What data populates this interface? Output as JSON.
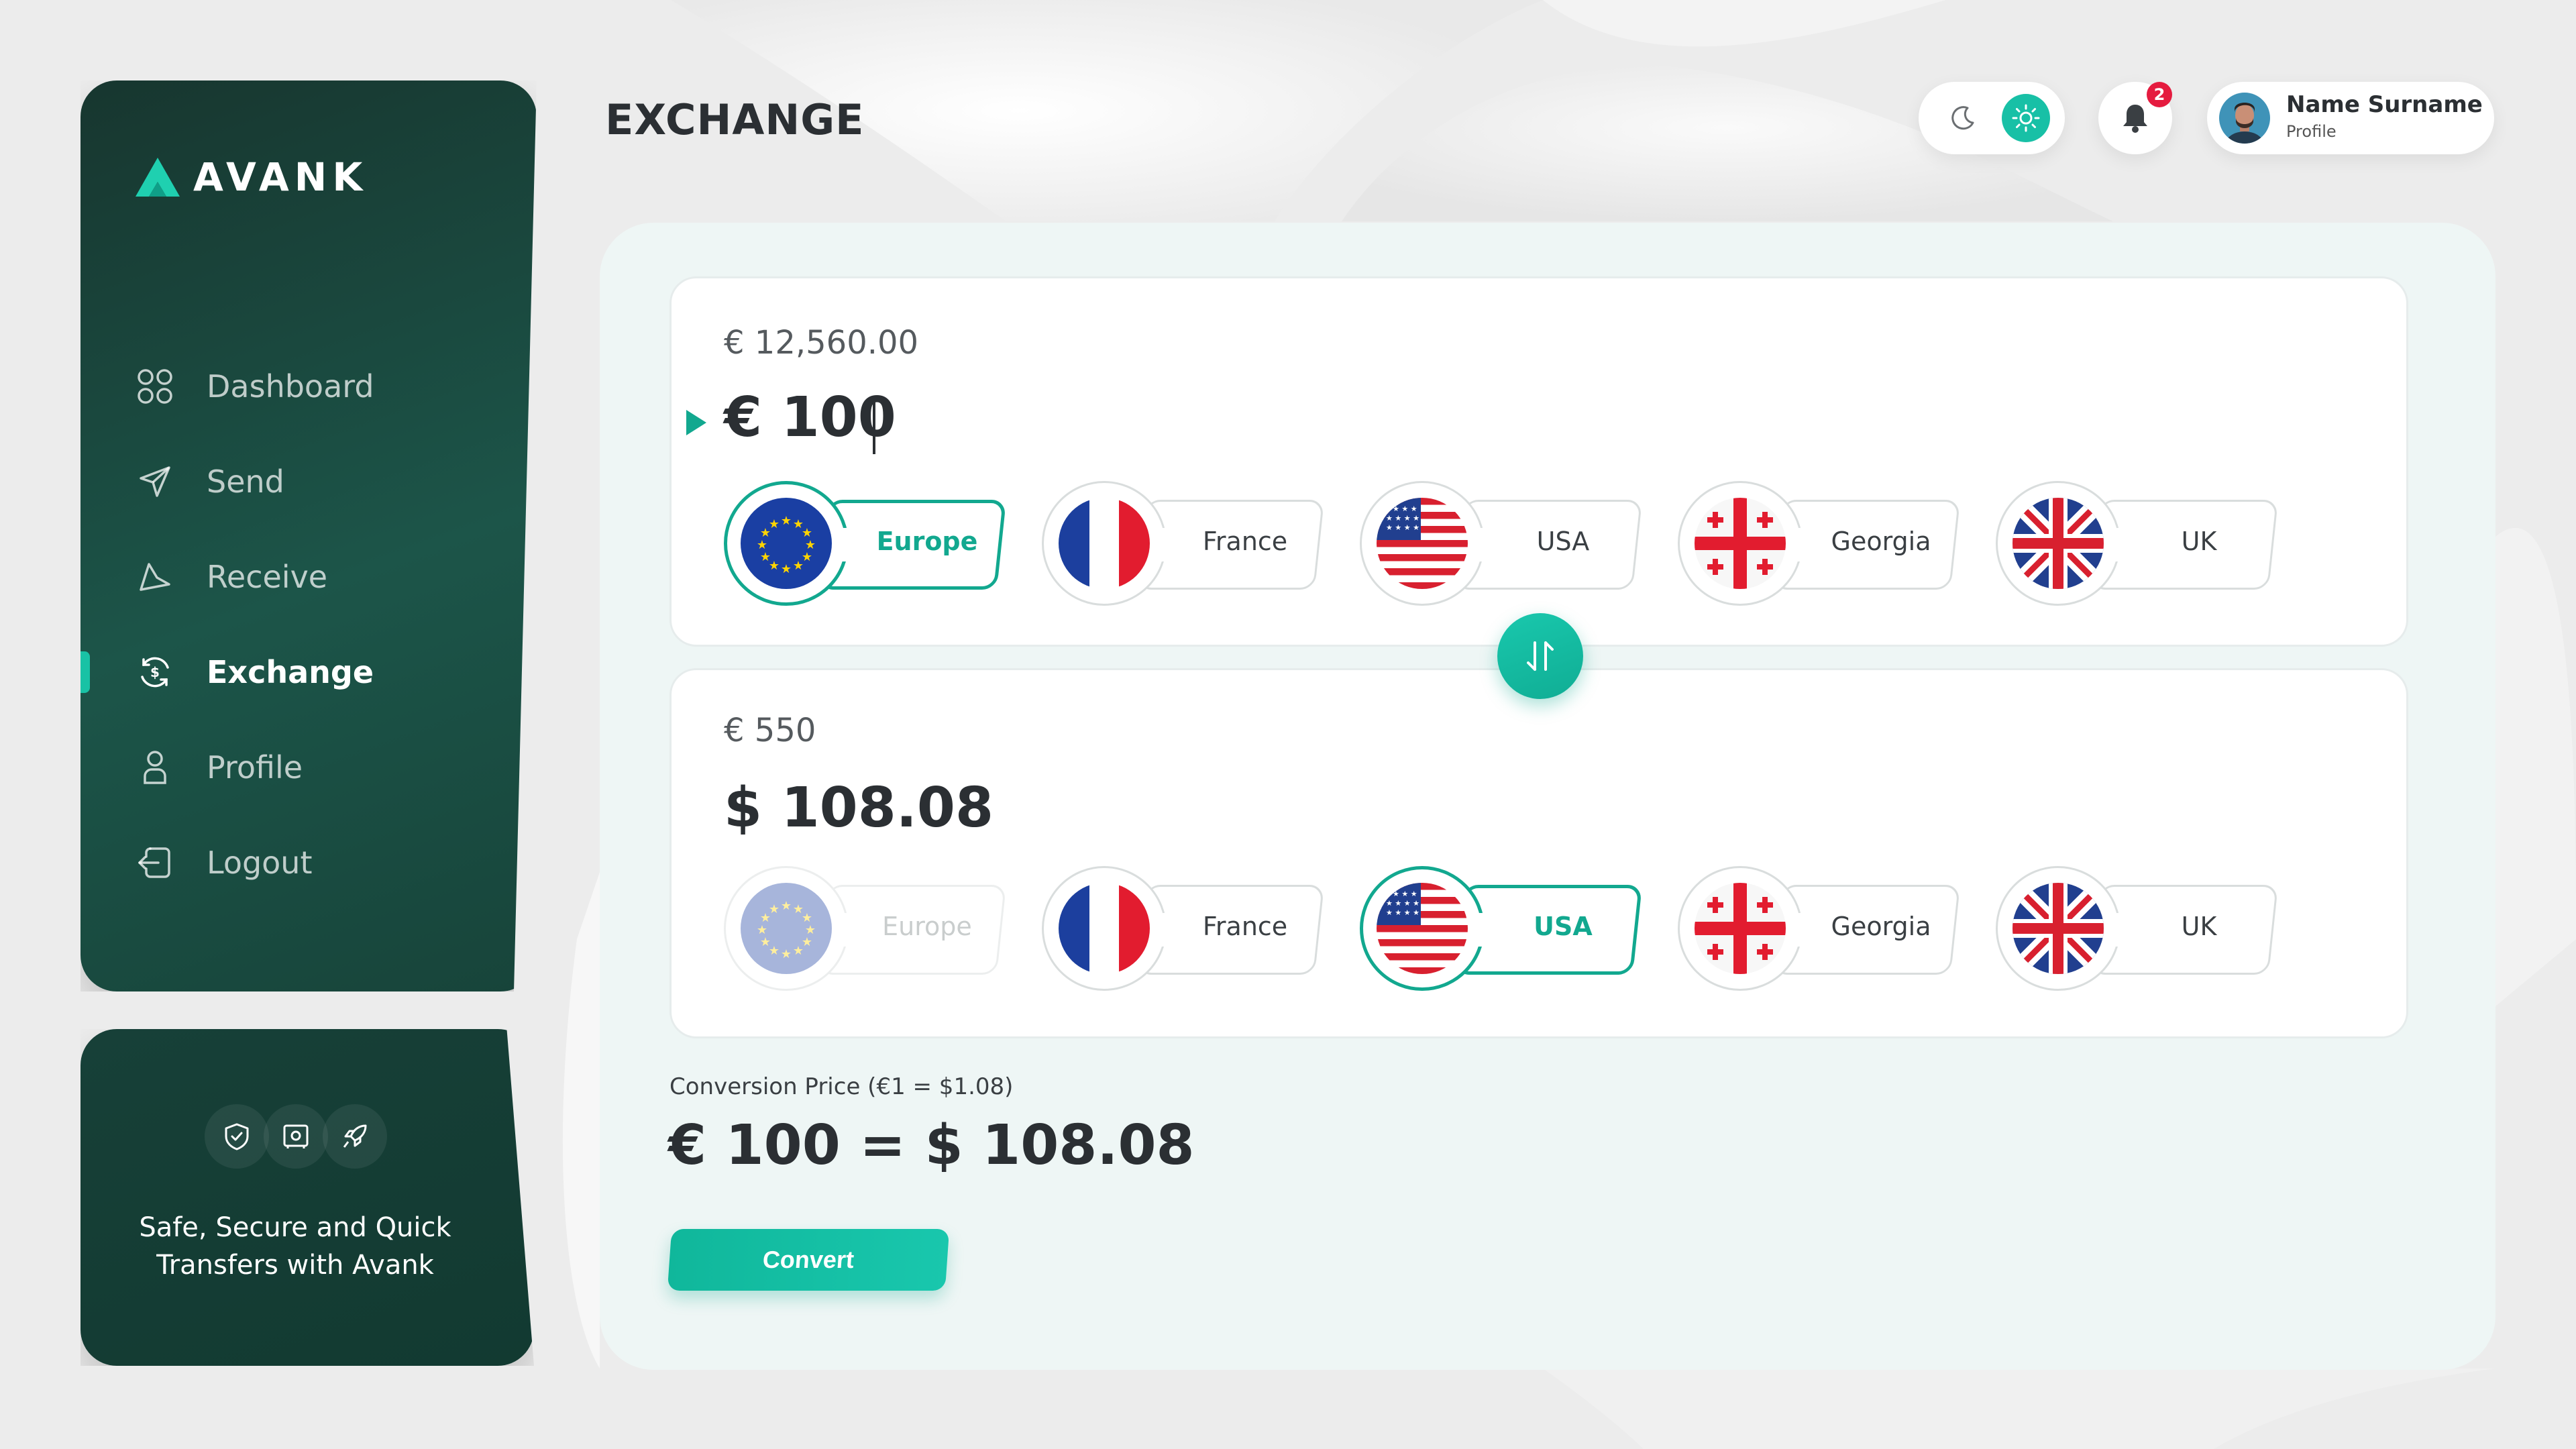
{
  "brand": {
    "name": "AVANK"
  },
  "page": {
    "title": "EXCHANGE"
  },
  "sidebar": {
    "items": [
      {
        "label": "Dashboard",
        "icon": "grid-icon"
      },
      {
        "label": "Send",
        "icon": "paper-plane-icon"
      },
      {
        "label": "Receive",
        "icon": "receive-icon"
      },
      {
        "label": "Exchange",
        "icon": "exchange-icon",
        "active": true
      },
      {
        "label": "Profile",
        "icon": "user-icon"
      },
      {
        "label": "Logout",
        "icon": "logout-icon"
      }
    ]
  },
  "promo": {
    "icons": [
      "shield-icon",
      "safe-icon",
      "rocket-icon"
    ],
    "line1_a": "Safe, ",
    "line1_b": "Secure",
    "line1_c": " and ",
    "line1_d": "Quick",
    "line2_a": "Transfers",
    "line2_b": " with ",
    "line2_c": "Avank"
  },
  "header": {
    "theme": {
      "modes": [
        "moon-icon",
        "sun-icon"
      ],
      "active": "sun-icon"
    },
    "notifications": {
      "count": "2"
    },
    "profile": {
      "name": "Name Surname",
      "subtitle": "Profile"
    }
  },
  "from": {
    "balance": "€ 12,560.00",
    "amount": "€ 100",
    "currencies": [
      {
        "name": "Europe",
        "flag": "eu-flag-icon",
        "state": "selected"
      },
      {
        "name": "France",
        "flag": "france-flag-icon",
        "state": "normal"
      },
      {
        "name": "USA",
        "flag": "usa-flag-icon",
        "state": "normal"
      },
      {
        "name": "Georgia",
        "flag": "georgia-flag-icon",
        "state": "normal"
      },
      {
        "name": "UK",
        "flag": "uk-flag-icon",
        "state": "normal"
      }
    ]
  },
  "to": {
    "balance": "€ 550",
    "amount": "$ 108.08",
    "currencies": [
      {
        "name": "Europe",
        "flag": "eu-flag-icon",
        "state": "disabled"
      },
      {
        "name": "France",
        "flag": "france-flag-icon",
        "state": "normal"
      },
      {
        "name": "USA",
        "flag": "usa-flag-icon",
        "state": "selected"
      },
      {
        "name": "Georgia",
        "flag": "georgia-flag-icon",
        "state": "normal"
      },
      {
        "name": "UK",
        "flag": "uk-flag-icon",
        "state": "normal"
      }
    ]
  },
  "conversion": {
    "label": "Conversion Price (€1 = $1.08)",
    "result": "€ 100 = $ 108.08",
    "button_label": "Convert"
  },
  "colors": {
    "accent": "#12A88F",
    "accent_light": "#19C2A5",
    "sidebar": "#1C5549",
    "badge": "#E51B3F"
  }
}
